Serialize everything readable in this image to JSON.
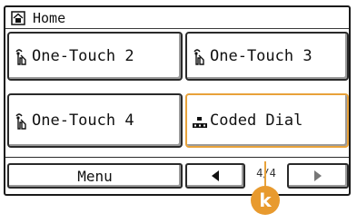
{
  "title": "Home",
  "tiles": [
    {
      "label": "One-Touch 2",
      "icon": "one-touch-icon"
    },
    {
      "label": "One-Touch 3",
      "icon": "one-touch-icon"
    },
    {
      "label": "One-Touch 4",
      "icon": "one-touch-icon"
    },
    {
      "label": "Coded Dial",
      "icon": "coded-dial-icon"
    }
  ],
  "bottom": {
    "menu_label": "Menu",
    "page_indicator": "4/4",
    "prev_icon": "triangle-left-icon",
    "next_icon": "triangle-right-icon"
  },
  "callout": {
    "label": "k",
    "color": "#e89a2e"
  },
  "colors": {
    "highlight": "#e8a23a"
  }
}
